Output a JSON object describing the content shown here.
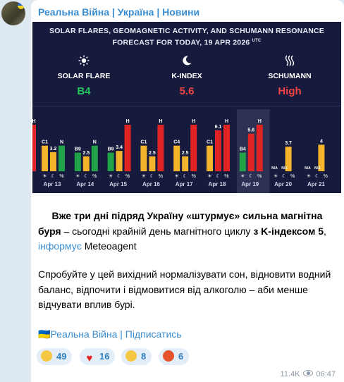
{
  "channel": {
    "name": "Реальна Війна | Україна | Новини"
  },
  "forecast": {
    "title_line1": "SOLAR FLARES, GEOMAGNETIC ACTIVITY, AND SCHUMANN RESONANCE",
    "title_line2": "FORECAST FOR TODAY, 19 APR 2026",
    "title_sup": "UTC",
    "indicators": [
      {
        "icon": "sun-icon",
        "label": "SOLAR FLARE",
        "value": "B4",
        "color": "#22c55e"
      },
      {
        "icon": "moon-icon",
        "label": "K-INDEX",
        "value": "5.6",
        "color": "#ef4444"
      },
      {
        "icon": "waves-icon",
        "label": "SCHUMANN",
        "value": "High",
        "color": "#ef4444"
      }
    ],
    "day_symbols": [
      "☀",
      "☾",
      "%"
    ]
  },
  "chart_data": {
    "type": "bar",
    "categories": [
      "Apr 13",
      "Apr 14",
      "Apr 15",
      "Apr 16",
      "Apr 17",
      "Apr 18",
      "Apr 19",
      "Apr 20",
      "Apr 21"
    ],
    "series": [
      {
        "name": "SOLAR FLARE",
        "labels": [
          "C1",
          "B9",
          "B9",
          "C1",
          "C4",
          "C1",
          "B4",
          "",
          ""
        ],
        "levels": [
          0.55,
          0.4,
          0.4,
          0.55,
          0.55,
          0.55,
          0.4,
          0,
          0
        ]
      },
      {
        "name": "K-INDEX",
        "values": [
          3.2,
          2.5,
          3.4,
          2.5,
          2.5,
          6.1,
          5.6,
          3.7,
          4
        ],
        "labels": [
          "3.2",
          "2.5",
          "3.4",
          "2.5",
          "2.5",
          "6.1",
          "5.6",
          "3.7",
          "4"
        ]
      },
      {
        "name": "SCHUMANN",
        "labels": [
          "N",
          "N",
          "H",
          "H",
          "H",
          "H",
          "H",
          "N/A",
          "N/A"
        ],
        "levels": [
          0.55,
          0.55,
          1,
          1,
          1,
          1,
          1,
          0,
          0
        ]
      }
    ],
    "extra_left_bar": {
      "label": "H",
      "level": 1
    },
    "highlight_category": "Apr 19",
    "colors": {
      "green": "#22a34a",
      "yellow": "#f4b42c",
      "red": "#e02424"
    }
  },
  "post": {
    "p1_bold": "Вже три дні підряд Україну «штурмує» сильна магнітна буря",
    "p1_mid": " – сьогодні крайній день магнітного циклу ",
    "p1_bold2": "з K-індексом 5",
    "p1_comma": ",",
    "link": "інформує",
    "source": " Meteoagent",
    "p2": "Спробуйте у цей вихідний нормалізувати сон, відновити водний баланс, відпочити і відмовитися від алкоголю – аби менше відчувати вплив бурі."
  },
  "footer": {
    "flag": "🇺🇦",
    "link": "Реальна Війна | Підписатись"
  },
  "reactions": [
    {
      "emoji": "crying-face",
      "count": "49"
    },
    {
      "emoji": "red-heart",
      "count": "16"
    },
    {
      "emoji": "grinning-face",
      "count": "8"
    },
    {
      "emoji": "angry-face",
      "count": "6"
    }
  ],
  "meta": {
    "views": "11.4K",
    "time": "06:47"
  }
}
